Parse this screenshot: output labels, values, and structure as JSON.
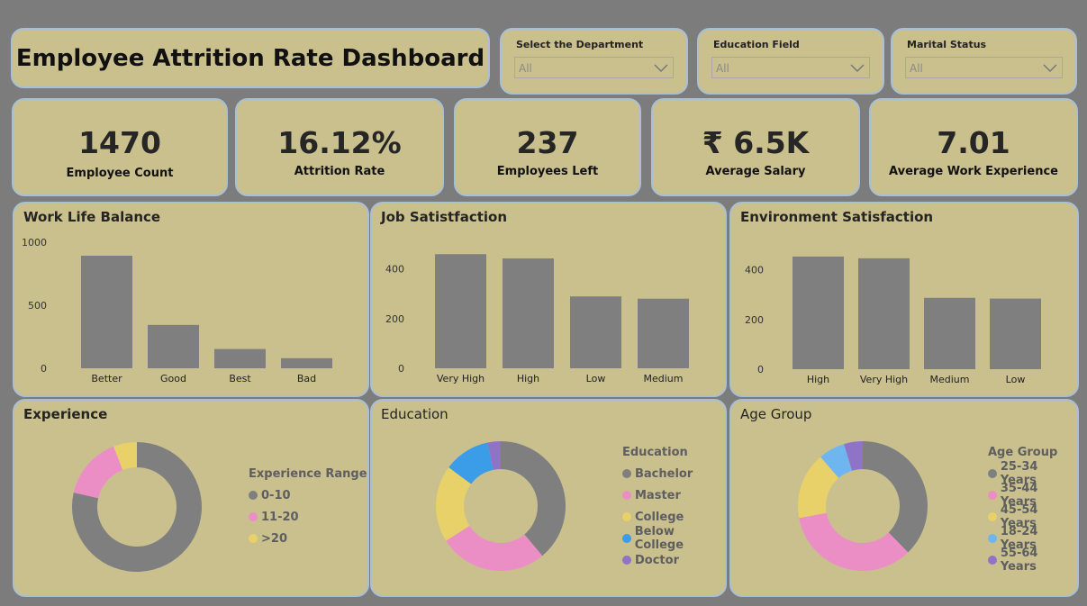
{
  "dashboard": {
    "title": "Employee Attrition Rate Dashboard"
  },
  "filters": [
    {
      "label": "Select the Department",
      "value": "All"
    },
    {
      "label": "Education Field",
      "value": "All"
    },
    {
      "label": "Marital Status",
      "value": "All"
    }
  ],
  "kpis": [
    {
      "value": "1470",
      "label": "Employee Count"
    },
    {
      "value": "16.12%",
      "label": "Attrition Rate"
    },
    {
      "value": "237",
      "label": "Employees Left"
    },
    {
      "value": "₹ 6.5K",
      "label": "Average Salary"
    },
    {
      "value": "7.01",
      "label": "Average Work Experience"
    }
  ],
  "colors": {
    "bar": "#7f7f7f",
    "panel": "#c9c08e",
    "border": "#a8bfd6",
    "background": "#7c7c7c"
  },
  "chart_data": [
    {
      "type": "bar",
      "title": "Work Life Balance",
      "categories": [
        "Better",
        "Good",
        "Best",
        "Bad"
      ],
      "values": [
        893,
        344,
        153,
        80
      ],
      "ylim": [
        0,
        1000
      ],
      "yticks": [
        0,
        500,
        1000
      ]
    },
    {
      "type": "bar",
      "title": "Job Satistfaction",
      "categories": [
        "Very High",
        "High",
        "Low",
        "Medium"
      ],
      "values": [
        459,
        442,
        289,
        280
      ],
      "ylim": [
        0,
        460
      ],
      "yticks": [
        0,
        200,
        400
      ]
    },
    {
      "type": "bar",
      "title": "Environment Satisfaction",
      "categories": [
        "High",
        "Very High",
        "Medium",
        "Low"
      ],
      "values": [
        453,
        446,
        287,
        284
      ],
      "ylim": [
        0,
        460
      ],
      "yticks": [
        0,
        200,
        400
      ]
    },
    {
      "type": "pie",
      "title": "Experience",
      "legend_title": "Experience Range",
      "labels": [
        "0-10",
        "11-20",
        ">20"
      ],
      "values": [
        1155,
        229,
        86
      ],
      "colors": [
        "#7f7f7f",
        "#ec8ec6",
        "#e8d168"
      ]
    },
    {
      "type": "pie",
      "title": "Education",
      "legend_title": "Education",
      "labels": [
        "Bachelor",
        "Master",
        "College",
        "Below College",
        "Doctor"
      ],
      "values": [
        572,
        398,
        282,
        170,
        48
      ],
      "colors": [
        "#7f7f7f",
        "#ec8ec6",
        "#e8d168",
        "#3b9ce8",
        "#8f73c7"
      ]
    },
    {
      "type": "pie",
      "title": "Age Group",
      "legend_title": "Age Group",
      "labels": [
        "25-34 Years",
        "35-44 Years",
        "45-54 Years",
        "18-24 Years",
        "55-64 Years"
      ],
      "values": [
        554,
        505,
        245,
        97,
        69
      ],
      "colors": [
        "#7f7f7f",
        "#ec8ec6",
        "#e8d168",
        "#6fb6f0",
        "#8f73c7"
      ]
    }
  ]
}
